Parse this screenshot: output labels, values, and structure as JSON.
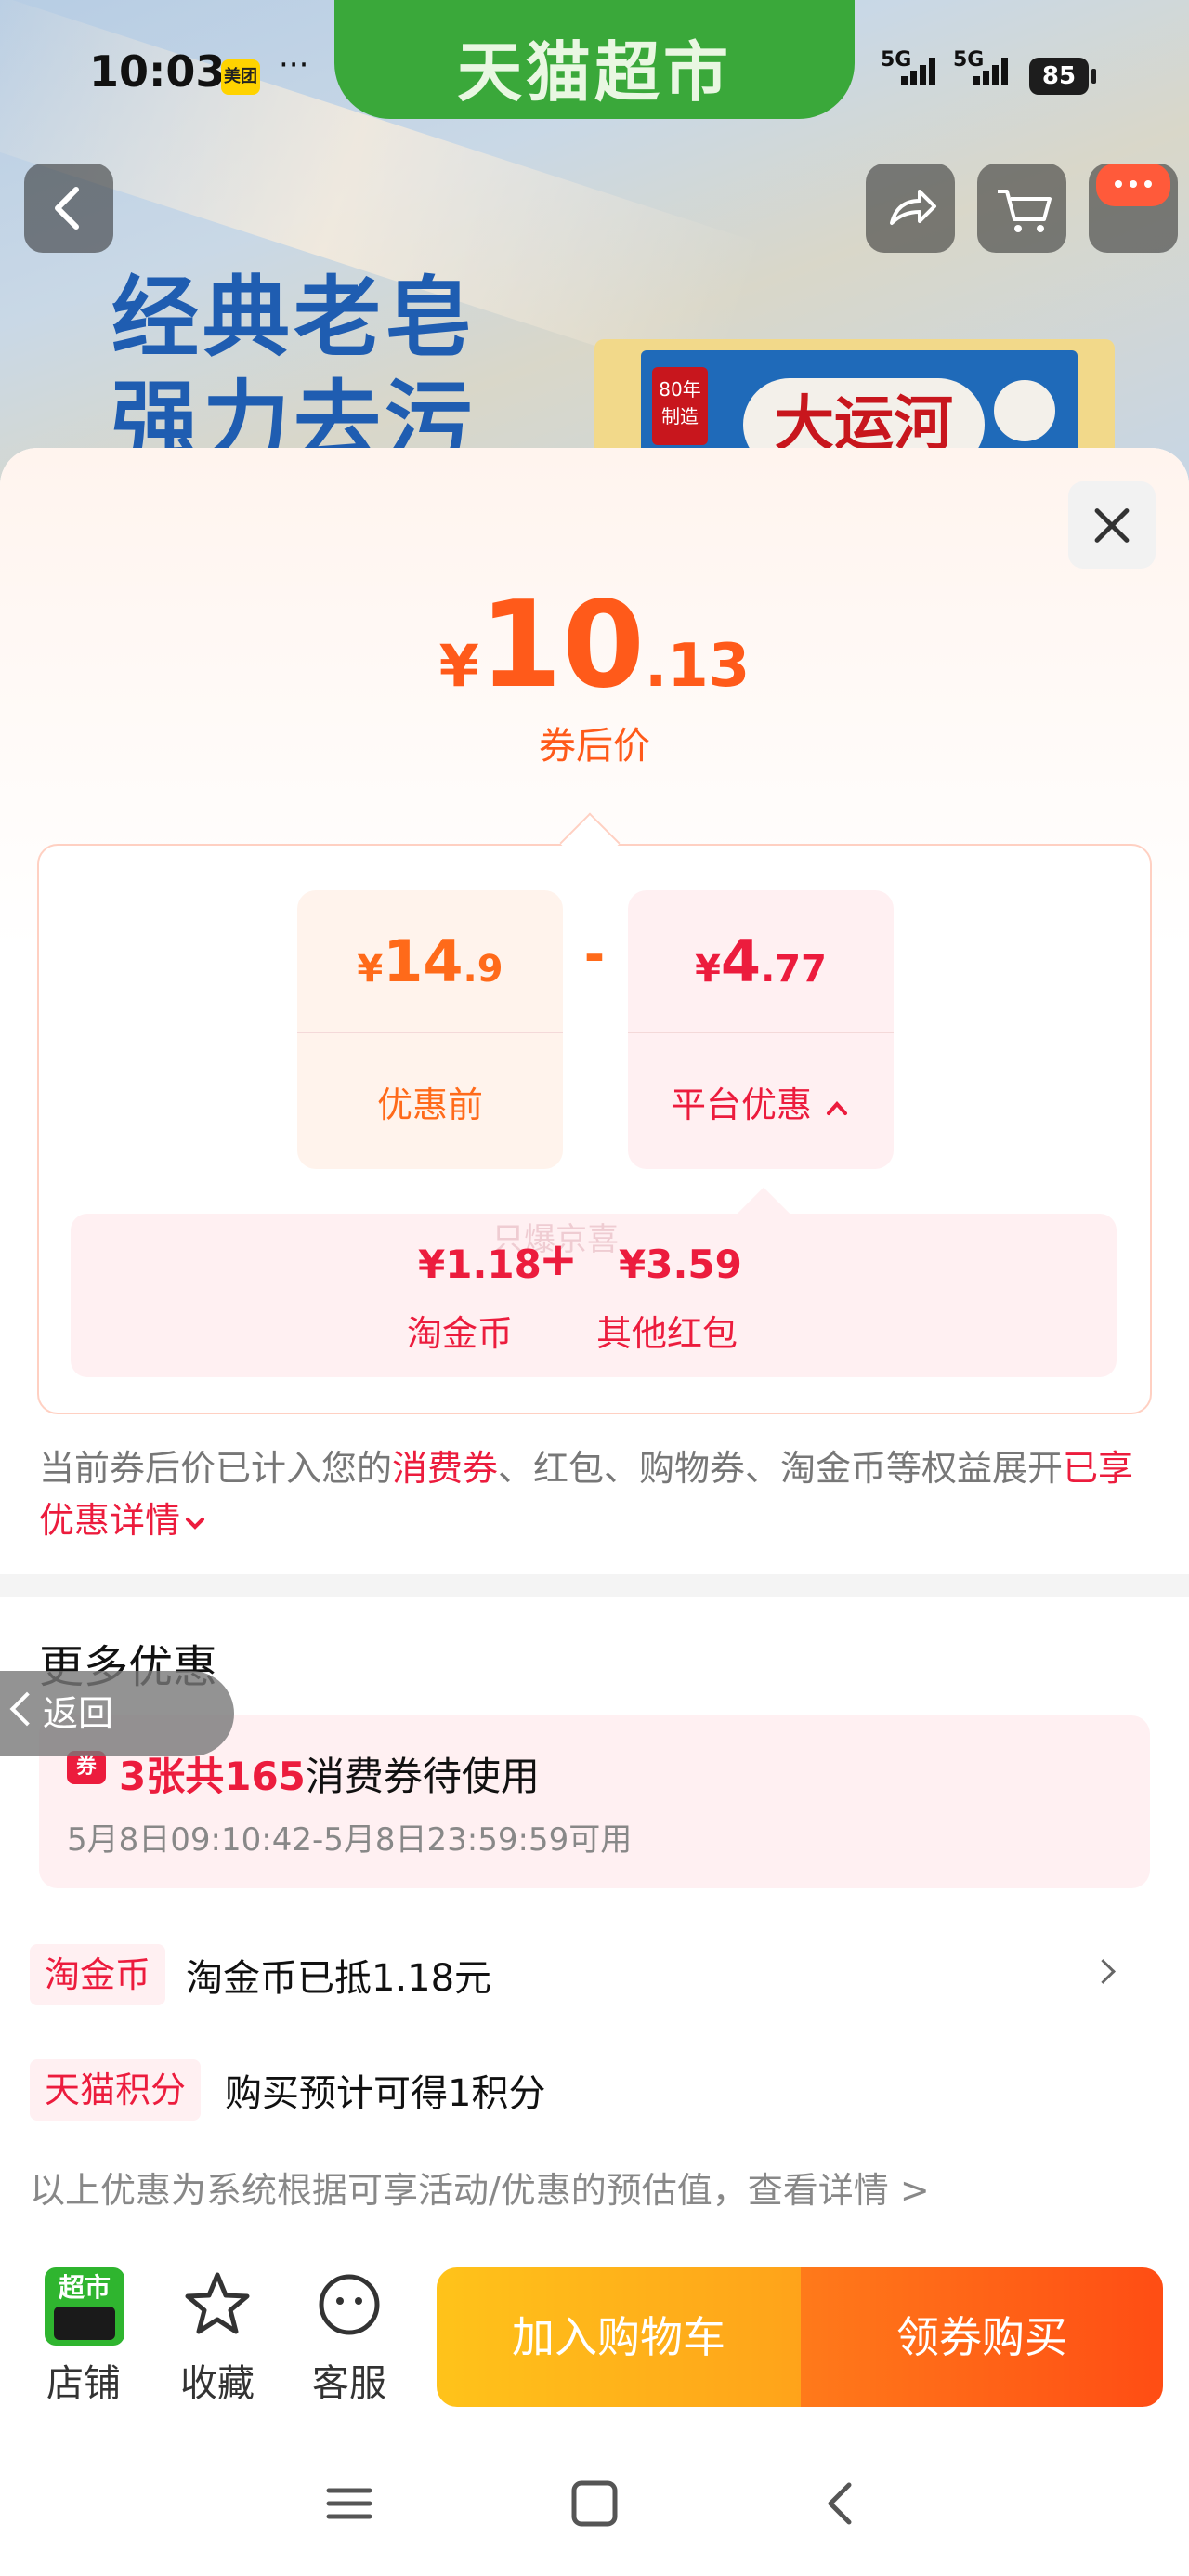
{
  "status_bar": {
    "time": "10:03",
    "meituan_badge": "美团",
    "dots": "···",
    "signal1": "5G",
    "signal2": "5G",
    "battery": "85"
  },
  "header": {
    "brand_title": "天猫超市"
  },
  "hero": {
    "line1": "经典老皂",
    "line2": "强力去污",
    "soap_brand": "大运河",
    "soap_tag": "80年制造"
  },
  "price_panel": {
    "currency": "¥",
    "integer": "10",
    "decimal": ".13",
    "label": "券后价"
  },
  "breakdown": {
    "original": {
      "currency": "¥",
      "integer": "14",
      "decimal": ".9",
      "label": "优惠前"
    },
    "operator": "-",
    "platform": {
      "currency": "¥",
      "integer": "4",
      "decimal": ".77",
      "label": "平台优惠",
      "chevron": "^"
    },
    "details": [
      {
        "amount": "¥1.18",
        "label": "淘金币"
      },
      {
        "amount": "¥3.59",
        "label": "其他红包"
      }
    ],
    "plus": "+",
    "watermark": "只爆京喜"
  },
  "note": {
    "part1": "当前券后价已计入您的",
    "highlight": "消费券",
    "part2": "、红包、购物券、淘金币等权益展开",
    "link": "已享优惠详情"
  },
  "more": {
    "title": "更多优惠",
    "back_label": "返回",
    "coupon": {
      "icon": "券",
      "highlight": "3张共165",
      "text": "消费券待使用",
      "time": "5月8日09:10:42-5月8日23:59:59可用"
    },
    "taojinbi": {
      "tag": "淘金币",
      "text": "淘金币已抵1.18元"
    },
    "points": {
      "tag": "天猫积分",
      "text": "购买预计可得1积分"
    },
    "disclaimer": "以上优惠为系统根据可享活动/优惠的预估值，查看详情 >"
  },
  "action_bar": {
    "store_icon_text": "超市",
    "store": "店铺",
    "favorite": "收藏",
    "service": "客服",
    "add_cart": "加入购物车",
    "buy": "领券购买"
  },
  "colors": {
    "accent_orange": "#ff5a1a",
    "accent_red": "#ec1c3d",
    "brand_green": "#3aa83a"
  }
}
